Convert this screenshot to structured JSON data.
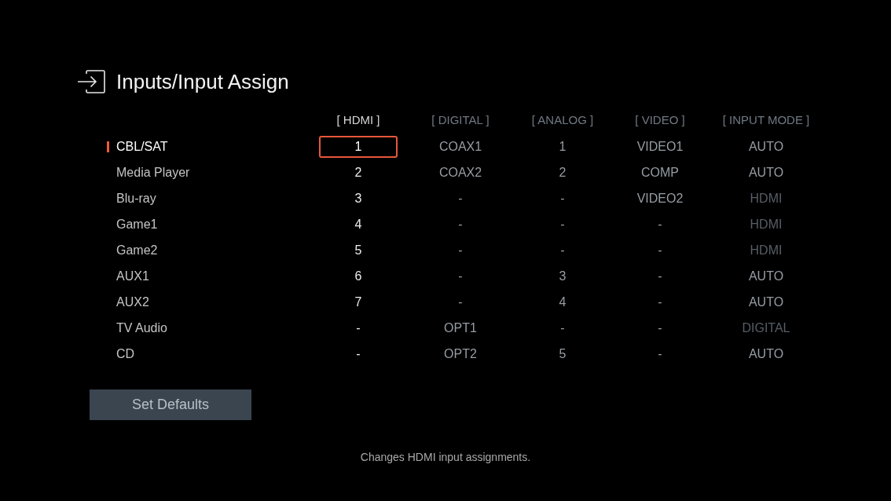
{
  "title": "Inputs/Input Assign",
  "columns": [
    {
      "label": "[ HDMI ]",
      "selected": true
    },
    {
      "label": "[ DIGITAL ]",
      "selected": false
    },
    {
      "label": "[ ANALOG ]",
      "selected": false
    },
    {
      "label": "[ VIDEO ]",
      "selected": false
    },
    {
      "label": "[ INPUT MODE ]",
      "selected": false
    }
  ],
  "rows": [
    {
      "label": "CBL/SAT",
      "selected": true,
      "cells": [
        "1",
        "COAX1",
        "1",
        "VIDEO1"
      ],
      "input_mode": {
        "text": "AUTO",
        "disabled": false
      }
    },
    {
      "label": "Media Player",
      "selected": false,
      "cells": [
        "2",
        "COAX2",
        "2",
        "COMP"
      ],
      "input_mode": {
        "text": "AUTO",
        "disabled": false
      }
    },
    {
      "label": "Blu-ray",
      "selected": false,
      "cells": [
        "3",
        "-",
        "-",
        "VIDEO2"
      ],
      "input_mode": {
        "text": "HDMI",
        "disabled": true
      }
    },
    {
      "label": "Game1",
      "selected": false,
      "cells": [
        "4",
        "-",
        "-",
        "-"
      ],
      "input_mode": {
        "text": "HDMI",
        "disabled": true
      }
    },
    {
      "label": "Game2",
      "selected": false,
      "cells": [
        "5",
        "-",
        "-",
        "-"
      ],
      "input_mode": {
        "text": "HDMI",
        "disabled": true
      }
    },
    {
      "label": "AUX1",
      "selected": false,
      "cells": [
        "6",
        "-",
        "3",
        "-"
      ],
      "input_mode": {
        "text": "AUTO",
        "disabled": false
      }
    },
    {
      "label": "AUX2",
      "selected": false,
      "cells": [
        "7",
        "-",
        "4",
        "-"
      ],
      "input_mode": {
        "text": "AUTO",
        "disabled": false
      }
    },
    {
      "label": "TV Audio",
      "selected": false,
      "cells": [
        "-",
        "OPT1",
        "-",
        "-"
      ],
      "input_mode": {
        "text": "DIGITAL",
        "disabled": true
      }
    },
    {
      "label": "CD",
      "selected": false,
      "cells": [
        "-",
        "OPT2",
        "5",
        "-"
      ],
      "input_mode": {
        "text": "AUTO",
        "disabled": false
      }
    }
  ],
  "button": "Set Defaults",
  "help_text": "Changes HDMI input assignments."
}
